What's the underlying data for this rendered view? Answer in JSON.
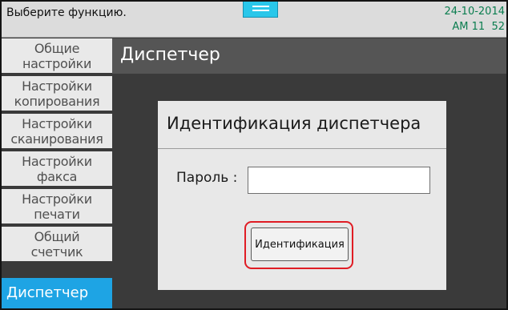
{
  "status": {
    "message": "Выберите функцию.",
    "date": "24-10-2014",
    "time": "AM 11  52"
  },
  "sidebar": {
    "items": [
      {
        "line1": "Общие",
        "line2": "настройки"
      },
      {
        "line1": "Настройки",
        "line2": "копирования"
      },
      {
        "line1": "Настройки",
        "line2": "сканирования"
      },
      {
        "line1": "Настройки",
        "line2": "факса"
      },
      {
        "line1": "Настройки",
        "line2": "печати"
      },
      {
        "line1": "Общий",
        "line2": "счетчик"
      }
    ],
    "active": "Диспетчер"
  },
  "main": {
    "title": "Диспетчер"
  },
  "dialog": {
    "title": "Идентификация диспетчера",
    "password_label": "Пароль :",
    "password_value": "",
    "button_label": "Идентификация"
  },
  "colors": {
    "accent": "#1ea4e4",
    "handle": "#29c7ea",
    "highlight_outline": "#e01c24",
    "clock": "#0a7d4f"
  },
  "icons": {
    "handle": "menu-handle-icon"
  }
}
